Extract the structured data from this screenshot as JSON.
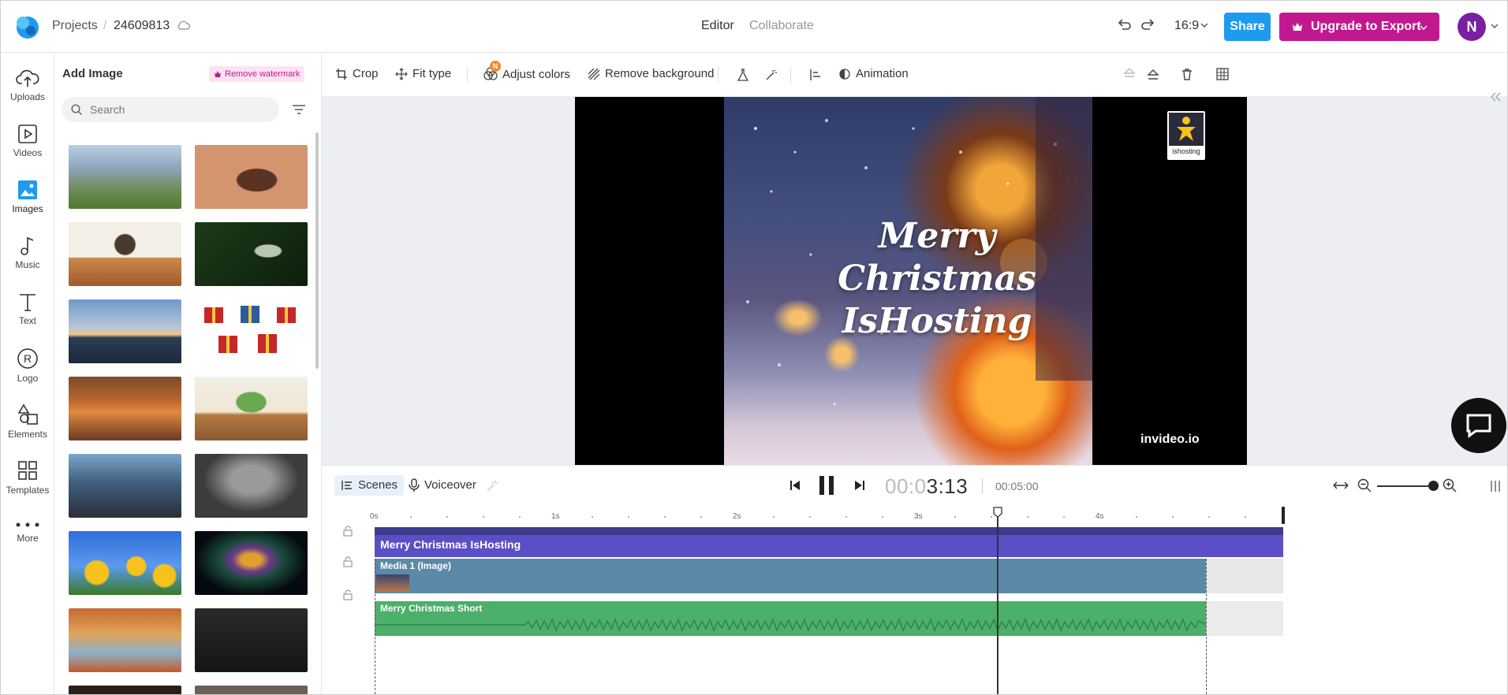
{
  "header": {
    "breadcrumb_projects": "Projects",
    "breadcrumb_sep": "/",
    "project_id": "24609813",
    "tab_editor": "Editor",
    "tab_collaborate": "Collaborate",
    "aspect_ratio": "16:9",
    "share_label": "Share",
    "upgrade_label": "Upgrade to Export",
    "avatar_initial": "N"
  },
  "rail": {
    "uploads": "Uploads",
    "videos": "Videos",
    "images": "Images",
    "music": "Music",
    "text": "Text",
    "logo": "Logo",
    "elements": "Elements",
    "templates": "Templates",
    "more": "More"
  },
  "panel": {
    "title": "Add Image",
    "remove_watermark": "Remove watermark",
    "search_placeholder": "Search"
  },
  "toolbar": {
    "crop": "Crop",
    "fit_type": "Fit type",
    "adjust_colors": "Adjust colors",
    "adjust_badge": "N",
    "remove_background": "Remove background",
    "animation": "Animation"
  },
  "preview": {
    "title_line1": "Merry",
    "title_line2": "Christmas",
    "title_line3": "IsHosting",
    "logo_label": "ishosting",
    "watermark": "invideo.io"
  },
  "timeline": {
    "scenes_label": "Scenes",
    "voiceover_label": "Voiceover",
    "current_time_dim": "00:0",
    "current_time": "3:13",
    "total_duration": "00:05:00",
    "ruler": [
      "0s",
      "1s",
      "2s",
      "3s",
      "4s"
    ],
    "track_text": "Merry Christmas IsHosting",
    "track_media": "Media 1 (Image)",
    "track_audio": "Merry Christmas Short"
  },
  "colors": {
    "accent_blue": "#1e9bf0",
    "upgrade_pink": "#c2188f",
    "text_track": "#5b4fc7",
    "media_track": "#5b89a8",
    "audio_track": "#4caf6a"
  }
}
